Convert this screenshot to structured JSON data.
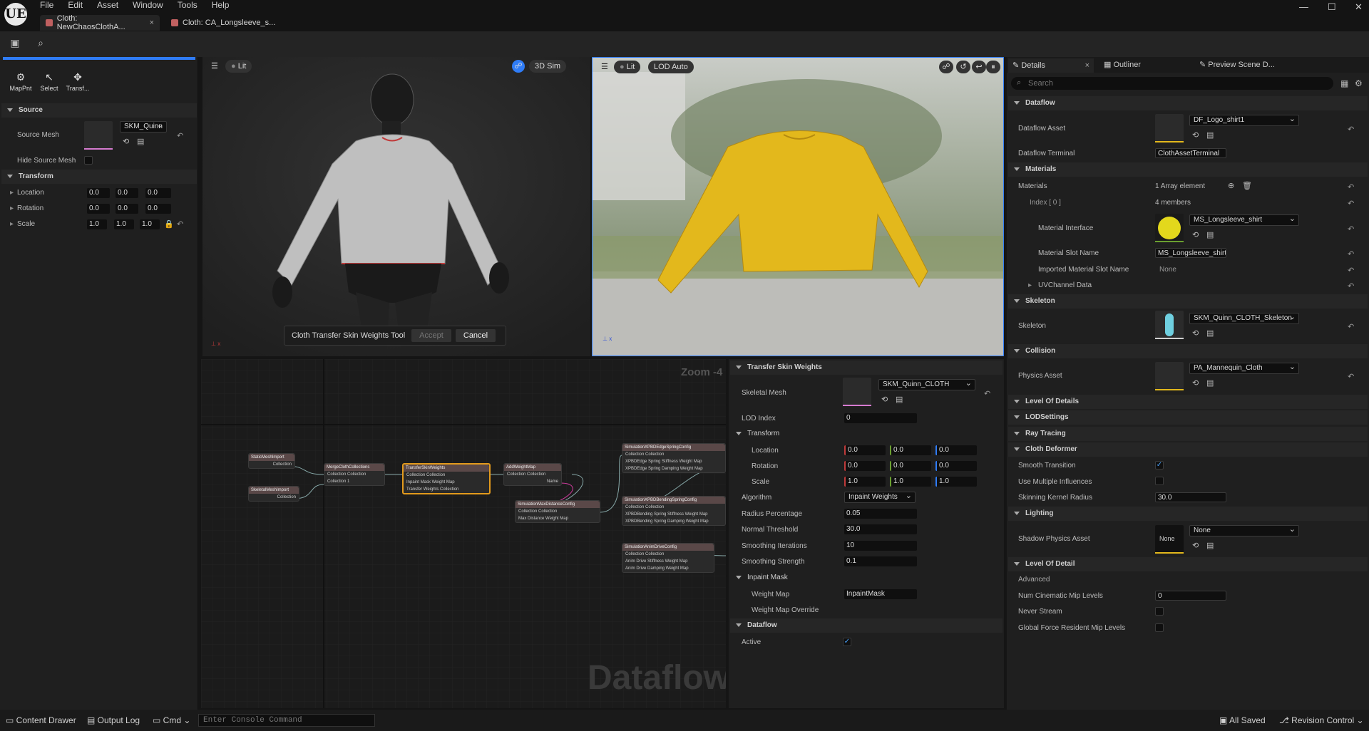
{
  "app": {
    "logo": "UE"
  },
  "menu": [
    "File",
    "Edit",
    "Asset",
    "Window",
    "Tools",
    "Help"
  ],
  "tabs": [
    {
      "label": "Cloth: NewChaosClothA...",
      "close": "×"
    },
    {
      "label": "Cloth: CA_Longsleeve_s..."
    }
  ],
  "window_controls": {
    "minimize": "—",
    "maximize": "☐",
    "close": "✕"
  },
  "tools": [
    {
      "label": "MapPnt",
      "icon": "map-points-icon"
    },
    {
      "label": "Select",
      "icon": "select-icon"
    },
    {
      "label": "Transf...",
      "icon": "transform-icon"
    }
  ],
  "left_panel": {
    "source_header": "Source",
    "source_mesh_label": "Source Mesh",
    "source_mesh_value": "SKM_Quinn",
    "hide_source_label": "Hide Source Mesh",
    "transform_header": "Transform",
    "rows": [
      {
        "label": "Location",
        "v": [
          "0.0",
          "0.0",
          "0.0"
        ]
      },
      {
        "label": "Rotation",
        "v": [
          "0.0",
          "0.0",
          "0.0"
        ]
      },
      {
        "label": "Scale",
        "v": [
          "1.0",
          "1.0",
          "1.0"
        ]
      }
    ]
  },
  "viewport_left": {
    "lit": "Lit",
    "sim": "3D Sim"
  },
  "viewport_right": {
    "lit": "Lit",
    "lod": "LOD Auto"
  },
  "tool_bar": {
    "title": "Cloth Transfer Skin Weights Tool",
    "accept": "Accept",
    "cancel": "Cancel"
  },
  "graph": {
    "zoom": "Zoom -4",
    "watermark": "Dataflow",
    "nodes": [
      {
        "title": "StaticMeshImport",
        "rows": [
          "Collection"
        ]
      },
      {
        "title": "SkeletalMeshImport",
        "rows": [
          "Collection"
        ]
      },
      {
        "title": "MergeClothCollections",
        "rows": [
          "Collection   Collection",
          "Collection 1"
        ]
      },
      {
        "title": "TransferSkinWeights",
        "rows": [
          "Collection   Collection",
          "Inpaint Mask Weight Map",
          "Transfer Weights Collection"
        ]
      },
      {
        "title": "AddWeightMap",
        "rows": [
          "Collection   Collection",
          "Name"
        ]
      },
      {
        "title": "SimulationMaxDistanceConfig",
        "rows": [
          "Collection   Collection",
          "Max Distance Weight Map"
        ]
      },
      {
        "title": "SimulationXPBDEdgeSpringConfig",
        "rows": [
          "Collection   Collection",
          "XPBDEdge Spring Stiffness Weight Map",
          "XPBDEdge Spring Damping Weight Map"
        ]
      },
      {
        "title": "SimulationXPBDBendingSpringConfig",
        "rows": [
          "Collection   Collection",
          "XPBDBending Spring Stiffness Weight Map",
          "XPBDBending Spring Damping Weight Map"
        ]
      },
      {
        "title": "SimulationAnimDriveConfig",
        "rows": [
          "Collection   Collection",
          "Anim Drive Stiffness Weight Map",
          "Anim Drive Damping Weight Map"
        ]
      }
    ]
  },
  "tsw": {
    "header": "Transfer Skin Weights",
    "skeletal_mesh_label": "Skeletal Mesh",
    "skeletal_mesh_value": "SKM_Quinn_CLOTH",
    "lod_label": "LOD Index",
    "lod_value": "0",
    "transform_header": "Transform",
    "rows": [
      {
        "label": "Location",
        "v": [
          "0.0",
          "0.0",
          "0.0"
        ]
      },
      {
        "label": "Rotation",
        "v": [
          "0.0",
          "0.0",
          "0.0"
        ]
      },
      {
        "label": "Scale",
        "v": [
          "1.0",
          "1.0",
          "1.0"
        ]
      }
    ],
    "algorithm_label": "Algorithm",
    "algorithm_value": "Inpaint Weights",
    "radius_label": "Radius Percentage",
    "radius_value": "0.05",
    "normal_label": "Normal Threshold",
    "normal_value": "30.0",
    "smooth_it_label": "Smoothing Iterations",
    "smooth_it_value": "10",
    "smooth_str_label": "Smoothing Strength",
    "smooth_str_value": "0.1",
    "inpaint_header": "Inpaint Mask",
    "weight_map_label": "Weight Map",
    "weight_map_value": "InpaintMask",
    "weight_override_label": "Weight Map Override",
    "dataflow_header": "Dataflow",
    "active_label": "Active",
    "check": "✓"
  },
  "details": {
    "tabs": [
      "Details",
      "Outliner",
      "Preview Scene D..."
    ],
    "search_placeholder": "Search",
    "sections": {
      "dataflow": "Dataflow",
      "materials": "Materials",
      "skeleton": "Skeleton",
      "collision": "Collision",
      "lod_details": "Level Of Details",
      "lod_settings": "LODSettings",
      "ray_tracing": "Ray Tracing",
      "cloth_deformer": "Cloth Deformer",
      "lighting": "Lighting",
      "level_of_detail": "Level Of Detail"
    },
    "dataflow_asset_label": "Dataflow Asset",
    "dataflow_asset_value": "DF_Logo_shirt1",
    "dataflow_terminal_label": "Dataflow Terminal",
    "dataflow_terminal_value": "ClothAssetTerminal",
    "materials_label": "Materials",
    "materials_value": "1 Array element",
    "index_label": "Index [ 0 ]",
    "index_value": "4 members",
    "mat_iface_label": "Material Interface",
    "mat_iface_value": "MS_Longsleeve_shirt",
    "slot_label": "Material Slot Name",
    "slot_value": "MS_Longsleeve_shirt",
    "imported_slot_label": "Imported Material Slot Name",
    "imported_slot_value": "None",
    "uv_label": "UVChannel Data",
    "skeleton_label": "Skeleton",
    "skeleton_value": "SKM_Quinn_CLOTH_Skeleton",
    "physics_label": "Physics Asset",
    "physics_value": "PA_Mannequin_Cloth",
    "smooth_trans_label": "Smooth Transition",
    "multi_infl_label": "Use Multiple Influences",
    "kernel_label": "Skinning Kernel Radius",
    "kernel_value": "30.0",
    "shadow_label": "Shadow Physics Asset",
    "shadow_value": "None",
    "shadow_thumb": "None",
    "advanced_label": "Advanced",
    "cine_label": "Num Cinematic Mip Levels",
    "cine_value": "0",
    "never_label": "Never Stream",
    "global_label": "Global Force Resident Mip Levels",
    "check": "✓"
  },
  "status": {
    "content_drawer": "Content Drawer",
    "output_log": "Output Log",
    "cmd": "Cmd",
    "console_placeholder": "Enter Console Command",
    "all_saved": "All Saved",
    "revision": "Revision Control"
  },
  "colors": {
    "accent": "#2f7cf6",
    "shirt": "#e3b81c",
    "node_select": "#e39a1c",
    "axis_red": "#c03b3b"
  }
}
